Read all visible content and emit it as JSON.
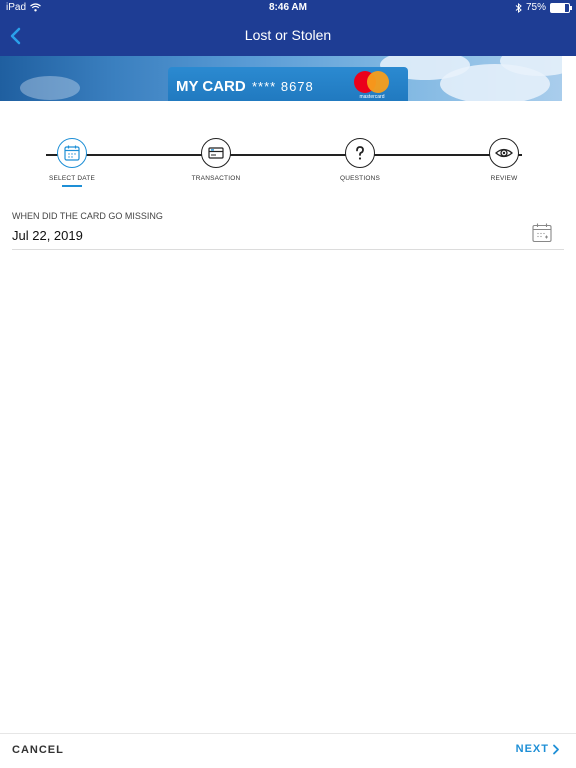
{
  "status_bar": {
    "device": "iPad",
    "time": "8:46 AM",
    "battery": "75%",
    "battery_level": 0.75
  },
  "nav": {
    "title": "Lost or Stolen",
    "back_icon": "chevron-left-icon"
  },
  "card": {
    "label": "MY CARD",
    "number": "**** 8678",
    "brand": "mastercard"
  },
  "stepper": {
    "steps": [
      {
        "label": "SELECT DATE",
        "icon": "calendar-icon",
        "active": true
      },
      {
        "label": "TRANSACTION",
        "icon": "credit-card-icon",
        "active": false
      },
      {
        "label": "QUESTIONS",
        "icon": "question-icon",
        "active": false
      },
      {
        "label": "REVIEW",
        "icon": "eye-icon",
        "active": false
      }
    ]
  },
  "date_field": {
    "label": "WHEN DID THE CARD GO MISSING",
    "value": "Jul 22, 2019",
    "icon": "calendar-icon"
  },
  "footer": {
    "cancel_label": "CANCEL",
    "next_label": "NEXT"
  },
  "colors": {
    "header": "#1e3d94",
    "accent": "#1e8fd6"
  }
}
